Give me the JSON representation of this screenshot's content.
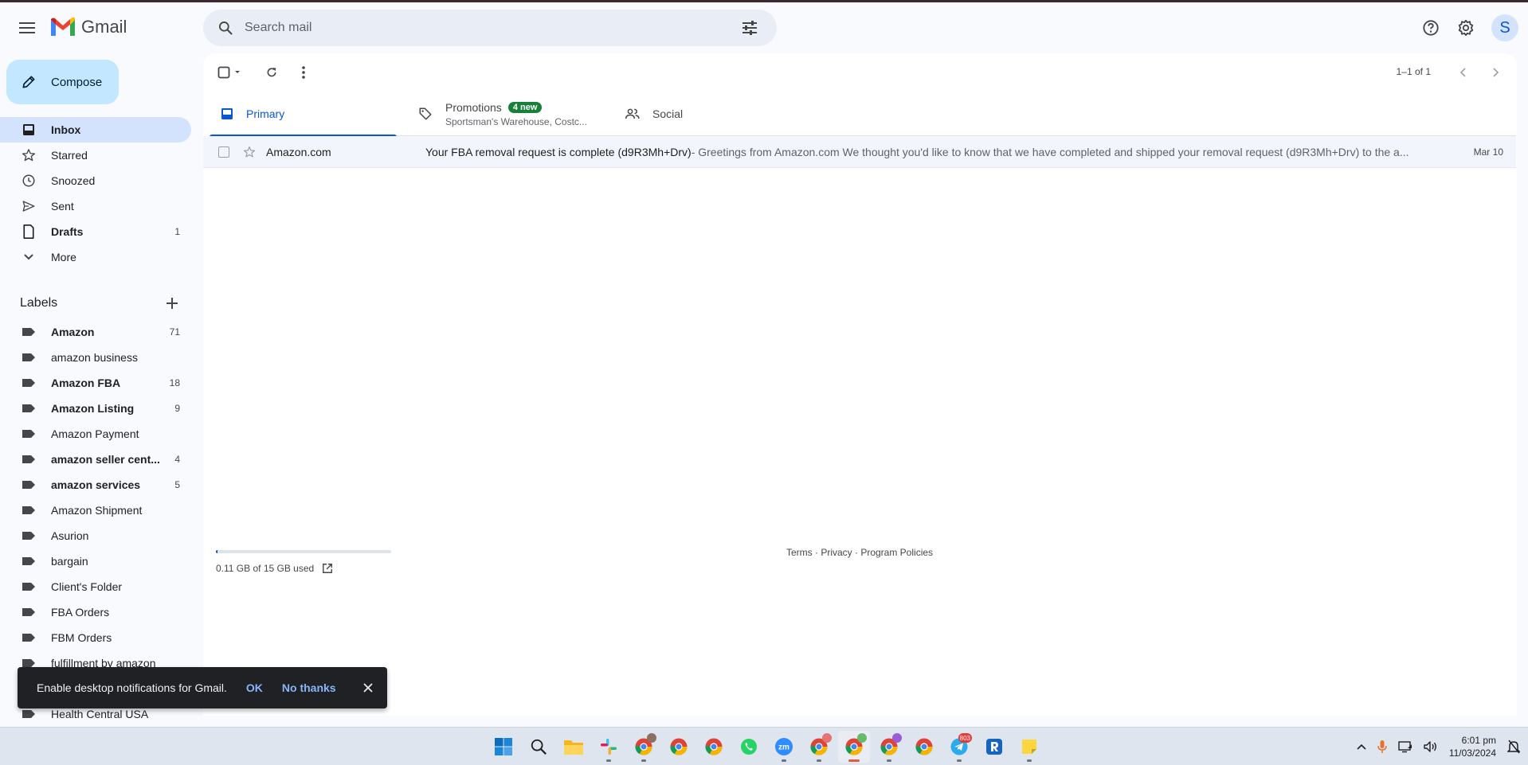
{
  "app": {
    "name": "Gmail"
  },
  "search": {
    "placeholder": "Search mail"
  },
  "header": {
    "avatar_letter": "S"
  },
  "compose": {
    "label": "Compose"
  },
  "nav": [
    {
      "label": "Inbox",
      "count": "",
      "icon": "inbox-icon",
      "active": true,
      "bold": true
    },
    {
      "label": "Starred",
      "count": "",
      "icon": "star-icon"
    },
    {
      "label": "Snoozed",
      "count": "",
      "icon": "clock-icon"
    },
    {
      "label": "Sent",
      "count": "",
      "icon": "send-icon"
    },
    {
      "label": "Drafts",
      "count": "1",
      "icon": "draft-icon",
      "bold": true
    },
    {
      "label": "More",
      "count": "",
      "icon": "chevron-down-icon"
    }
  ],
  "labels_heading": "Labels",
  "labels": [
    {
      "label": "Amazon",
      "count": "71",
      "bold": true
    },
    {
      "label": "amazon business",
      "count": ""
    },
    {
      "label": "Amazon FBA",
      "count": "18",
      "bold": true
    },
    {
      "label": "Amazon Listing",
      "count": "9",
      "bold": true
    },
    {
      "label": "Amazon Payment",
      "count": ""
    },
    {
      "label": "amazon seller cent...",
      "count": "4",
      "bold": true
    },
    {
      "label": "amazon services",
      "count": "5",
      "bold": true
    },
    {
      "label": "Amazon Shipment",
      "count": ""
    },
    {
      "label": "Asurion",
      "count": ""
    },
    {
      "label": "bargain",
      "count": ""
    },
    {
      "label": "Client's Folder",
      "count": ""
    },
    {
      "label": "FBA Orders",
      "count": ""
    },
    {
      "label": "FBM Orders",
      "count": ""
    },
    {
      "label": "fulfillment by amazon",
      "count": ""
    },
    {
      "label": "",
      "count": ""
    },
    {
      "label": "Health Central USA",
      "count": ""
    }
  ],
  "toolbar": {
    "pager": "1–1 of 1"
  },
  "tabs": {
    "primary": {
      "label": "Primary"
    },
    "promotions": {
      "label": "Promotions",
      "badge": "4 new",
      "sub": "Sportsman's Warehouse, Costc..."
    },
    "social": {
      "label": "Social"
    }
  },
  "emails": [
    {
      "sender": "Amazon.com",
      "subject": "Your FBA removal request is complete (d9R3Mh+Drv)",
      "snippet": " - Greetings from Amazon.com We thought you'd like to know that we have completed and shipped your removal request (d9R3Mh+Drv) to the a...",
      "date": "Mar 10"
    }
  ],
  "storage": {
    "text": "0.11 GB of 15 GB used",
    "fraction": 0.007
  },
  "footer": {
    "links": "Terms · Privacy · Program Policies"
  },
  "snackbar": {
    "message": "Enable desktop notifications for Gmail.",
    "ok": "OK",
    "no": "No thanks"
  },
  "taskbar": {
    "time": "6:01 pm",
    "date": "11/03/2024",
    "telegram_badge": "803"
  },
  "colors": {
    "accent": "#0b57d0",
    "compose_bg": "#c2e7ff",
    "active_nav": "#d3e3fd",
    "badge_green": "#188038"
  }
}
